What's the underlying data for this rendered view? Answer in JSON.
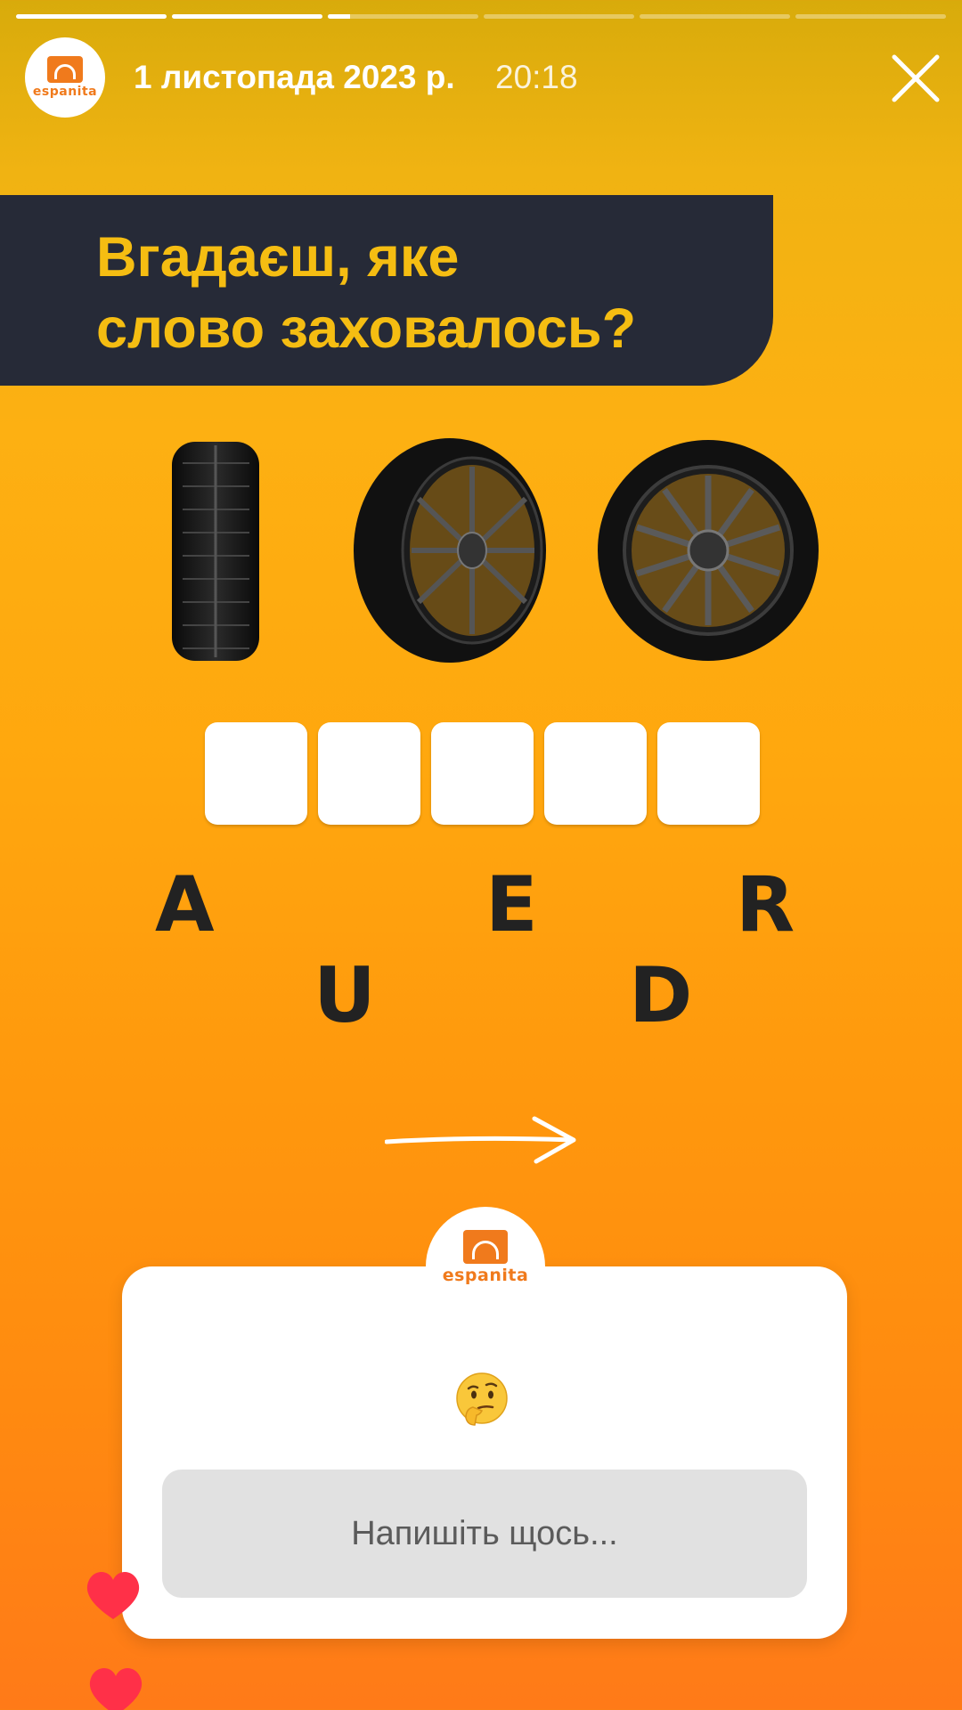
{
  "story": {
    "progress": [
      1,
      1,
      0.15,
      0,
      0,
      0
    ],
    "account_logo_text": "espanita",
    "date": "1 листопада 2023 р.",
    "time": "20:18",
    "close_icon": "close-icon"
  },
  "banner": {
    "title_line1": "Вгадаєш, яке",
    "title_line2": "слово заховалось?"
  },
  "puzzle": {
    "slot_count": 5,
    "letters": [
      "A",
      "E",
      "R",
      "U",
      "D"
    ]
  },
  "sticker": {
    "logo_text": "espanita",
    "emoji": "thinking-face-emoji",
    "placeholder": "Напишіть щось..."
  },
  "colors": {
    "banner_bg": "#262a37",
    "banner_text": "#f5bd12",
    "brand": "#f07a1c",
    "heart": "#ff3048"
  }
}
